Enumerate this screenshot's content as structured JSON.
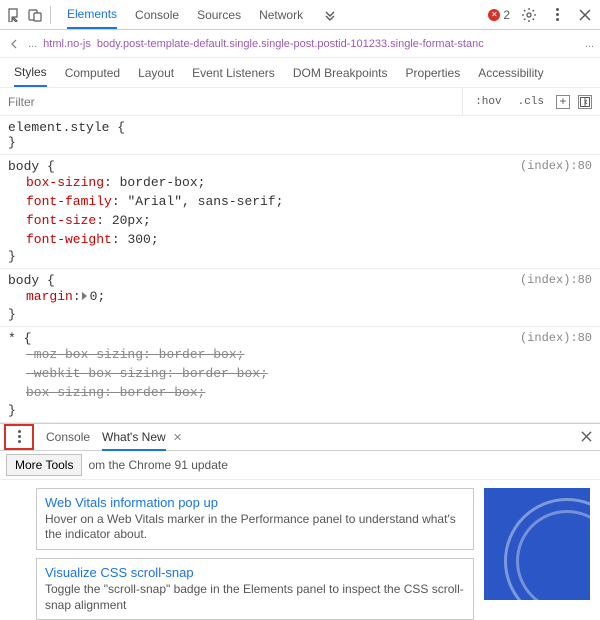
{
  "toolbar": {
    "main_tabs": [
      "Elements",
      "Console",
      "Sources",
      "Network"
    ],
    "active_main_tab": 0,
    "error_count": "2"
  },
  "breadcrumb": {
    "ellipsis": "...",
    "html": "html.no-js",
    "body": "body.post-template-default.single.single-post.postid-101233.single-format-stanc",
    "trailing": "..."
  },
  "styles_panel": {
    "tabs": [
      "Styles",
      "Computed",
      "Layout",
      "Event Listeners",
      "DOM Breakpoints",
      "Properties",
      "Accessibility"
    ],
    "active_tab": 0,
    "filter_placeholder": "Filter",
    "hov": ":hov",
    "cls": ".cls"
  },
  "rules": [
    {
      "selector": "element.style",
      "source": "",
      "declarations": []
    },
    {
      "selector": "body",
      "source": "(index):80",
      "declarations": [
        {
          "prop": "box-sizing",
          "val": "border-box",
          "struck": false
        },
        {
          "prop": "font-family",
          "val": "\"Arial\", sans-serif",
          "struck": false
        },
        {
          "prop": "font-size",
          "val": "20px",
          "struck": false
        },
        {
          "prop": "font-weight",
          "val": "300",
          "struck": false
        }
      ]
    },
    {
      "selector": "body",
      "source": "(index):80",
      "declarations": [
        {
          "prop": "margin",
          "val": "0",
          "struck": false,
          "expandable": true
        }
      ]
    },
    {
      "selector": "*",
      "source": "(index):80",
      "declarations": [
        {
          "prop": "-moz-box-sizing",
          "val": "border-box",
          "struck": true
        },
        {
          "prop": "-webkit-box-sizing",
          "val": "border-box",
          "struck": true
        },
        {
          "prop": "box-sizing",
          "val": "border-box",
          "struck": true
        }
      ]
    }
  ],
  "drawer": {
    "tabs": [
      {
        "label": "Console",
        "active": false,
        "closable": false
      },
      {
        "label": "What's New",
        "active": true,
        "closable": true
      }
    ],
    "more_tools_label": "More Tools",
    "subtitle_fragment": "om the Chrome 91 update"
  },
  "whatsnew": {
    "cards": [
      {
        "title": "Web Vitals information pop up",
        "desc": "Hover on a Web Vitals marker in the Performance panel to understand what's the indicator about."
      },
      {
        "title": "Visualize CSS scroll-snap",
        "desc": "Toggle the \"scroll-snap\" badge in the Elements panel to inspect the CSS scroll-snap alignment"
      }
    ]
  }
}
